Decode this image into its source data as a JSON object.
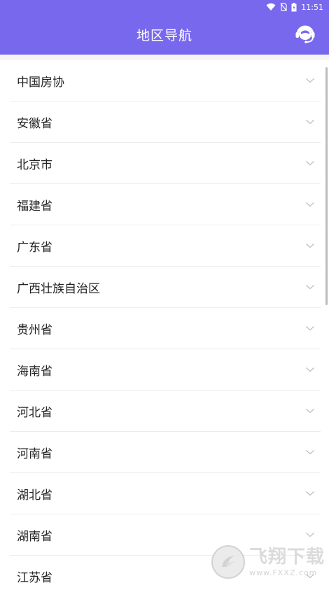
{
  "status_bar": {
    "time": "11:51"
  },
  "header": {
    "title": "地区导航",
    "support_icon": "headset-icon"
  },
  "regions": [
    "中国房协",
    "安徽省",
    "北京市",
    "福建省",
    "广东省",
    "广西壮族自治区",
    "贵州省",
    "海南省",
    "河北省",
    "河南省",
    "湖北省",
    "湖南省",
    "江苏省"
  ],
  "watermark": {
    "main": "飞翔下载",
    "sub": "www.FXXZ.com"
  },
  "colors": {
    "header": "#7868ee",
    "divider": "#ededed",
    "text": "#222222"
  }
}
